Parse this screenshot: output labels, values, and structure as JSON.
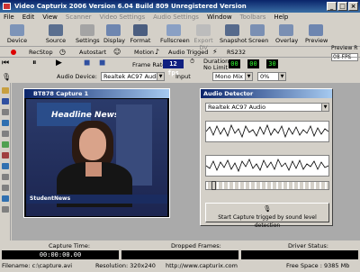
{
  "window": {
    "title": "Video Capturix 2006 Version 6.04 Build 809 Unregistered Version"
  },
  "menu": [
    "File",
    "Edit",
    "View",
    "Scanner",
    "Video Settings",
    "Audio Settings",
    "Window",
    "Toolbars",
    "Help"
  ],
  "toolbar": {
    "device": "Device",
    "source": "Source",
    "settings": "Settings",
    "display": "Display",
    "format": "Format",
    "fullscreen": "Fullscreen",
    "export_dv": "Export DV",
    "snapshot": "Snapshot",
    "screen": "Screen",
    "overlay": "Overlay",
    "preview": "Preview",
    "preview_rate_label": "Preview R",
    "preview_rate_value": "08 FPS"
  },
  "toolbar2": {
    "recstop": "RecStop",
    "autostart": "Autostart",
    "motion": "Motion",
    "audio_trigger": "Audio Trigged",
    "rs232": "RS232"
  },
  "toolbar3": {
    "frame_rate_label": "Frame Rate:",
    "frame_rate_value": "12 fps",
    "duration_label": "Duration:",
    "duration_value": "No Limit",
    "time_h": "00",
    "time_m": "00",
    "time_s": "30",
    "audio_device_label": "Audio Device:",
    "audio_device_value": "Realtek AC97 Audio",
    "input_label": "Input",
    "input_value": "Mono Mix",
    "volume_value": "0%"
  },
  "capture_window": {
    "title": "BT878 Capture 1",
    "overlay_top": "Headline News",
    "overlay_bottom": "StudentNews"
  },
  "audio_detector": {
    "title": "Audio Detector",
    "device": "Realtek AC97 Audio",
    "start_button": "Start Capture trigged by sound level detection"
  },
  "status": {
    "capture_time_label": "Capture Time:",
    "capture_time_value": "00:00:00.00",
    "dropped_frames_label": "Dropped Frames:",
    "driver_status_label": "Driver Status:",
    "filename": "Filename: c:\\capture.avi",
    "resolution": "Resolution: 320x240",
    "url": "http://www.capturix.com",
    "free_space": "Free Space : 9385 Mb"
  },
  "colors": {
    "title_bar": "#0a246a",
    "accent_red": "#cc1111",
    "digital_green": "#33ff33"
  }
}
